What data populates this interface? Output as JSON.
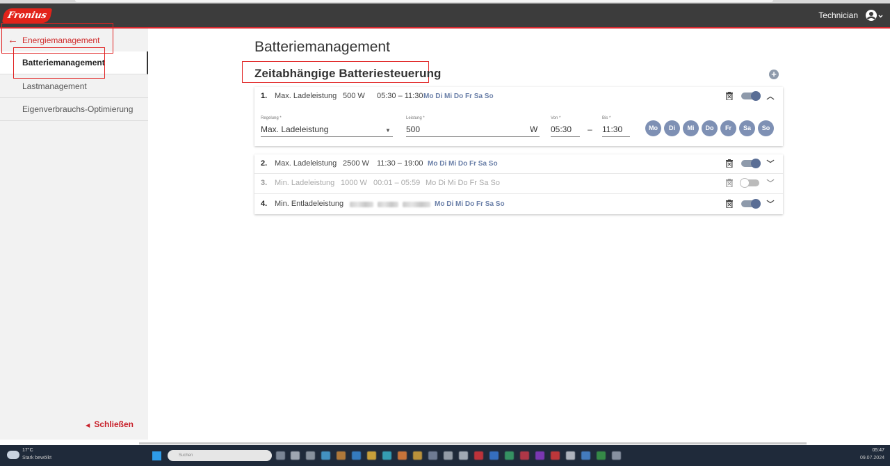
{
  "header": {
    "logo_text": "Fronius",
    "user_label": "Technician"
  },
  "sidebar": {
    "back_label": "Energiemanagement",
    "items": [
      {
        "label": "Batteriemanagement",
        "active": true
      },
      {
        "label": "Lastmanagement",
        "active": false
      },
      {
        "label": "Eigenverbrauchs-Optimierung",
        "active": false
      }
    ],
    "close_label": "Schließen"
  },
  "main": {
    "title": "Batteriemanagement",
    "section_title": "Zeitabhängige Batteriesteuerung"
  },
  "schedules": [
    {
      "num": "1.",
      "type": "Max. Ladeleistung",
      "power": "500 W",
      "time": "05:30 – 11:30",
      "days": "Mo Di Mi Do Fr Sa So",
      "enabled": true,
      "expanded": true
    },
    {
      "num": "2.",
      "type": "Max. Ladeleistung",
      "power": "2500 W",
      "time": "11:30 – 19:00",
      "days": "Mo Di Mi Do Fr Sa So",
      "enabled": true,
      "expanded": false
    },
    {
      "num": "3.",
      "type": "Min. Ladeleistung",
      "power": "1000 W",
      "time": "00:01 – 05:59",
      "days": "Mo Di Mi Do Fr Sa So",
      "enabled": false,
      "expanded": false
    },
    {
      "num": "4.",
      "type": "Min. Entladeleistung",
      "power": "",
      "time": "",
      "days": "Mo Di Mi Do Fr Sa So",
      "enabled": true,
      "expanded": false
    }
  ],
  "editor": {
    "regelung_label": "Regelung *",
    "regelung_value": "Max. Ladeleistung",
    "leistung_label": "Leistung *",
    "leistung_value": "500",
    "leistung_unit": "W",
    "von_label": "Von *",
    "von_value": "05:30",
    "dash": "–",
    "bis_label": "Bis *",
    "bis_value": "11:30",
    "days": [
      "Mo",
      "Di",
      "Mi",
      "Do",
      "Fr",
      "Sa",
      "So"
    ]
  },
  "taskbar": {
    "weather_temp": "17°C",
    "weather_desc": "Stark bewölkt",
    "search_placeholder": "Suchen",
    "time": "05:47",
    "date": "09.07.2024"
  },
  "colors": {
    "brand_red": "#e2231a",
    "accent_blue": "#5a6e95",
    "day_button": "#7e90b4"
  }
}
